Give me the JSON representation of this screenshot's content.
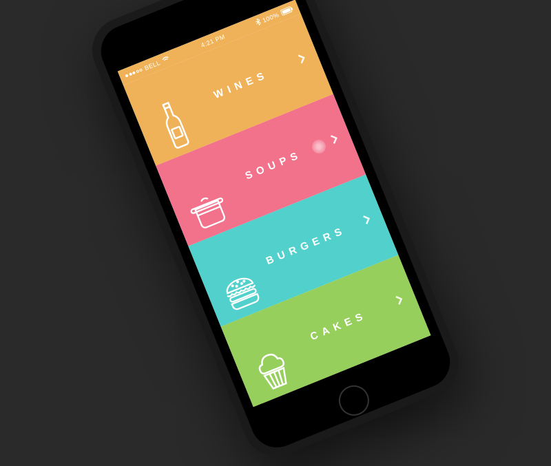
{
  "statusBar": {
    "carrier": "BELL",
    "time": "4:21 PM",
    "battery": "100%"
  },
  "categories": [
    {
      "id": "wines",
      "label": "WINES",
      "color": "#F0B259",
      "icon": "wine-bottle-icon"
    },
    {
      "id": "soups",
      "label": "SOUPS",
      "color": "#F2728C",
      "icon": "pot-icon"
    },
    {
      "id": "burgers",
      "label": "BURGERS",
      "color": "#52D0CC",
      "icon": "burger-icon"
    },
    {
      "id": "cakes",
      "label": "CAKES",
      "color": "#96CF5C",
      "icon": "cupcake-icon"
    }
  ]
}
